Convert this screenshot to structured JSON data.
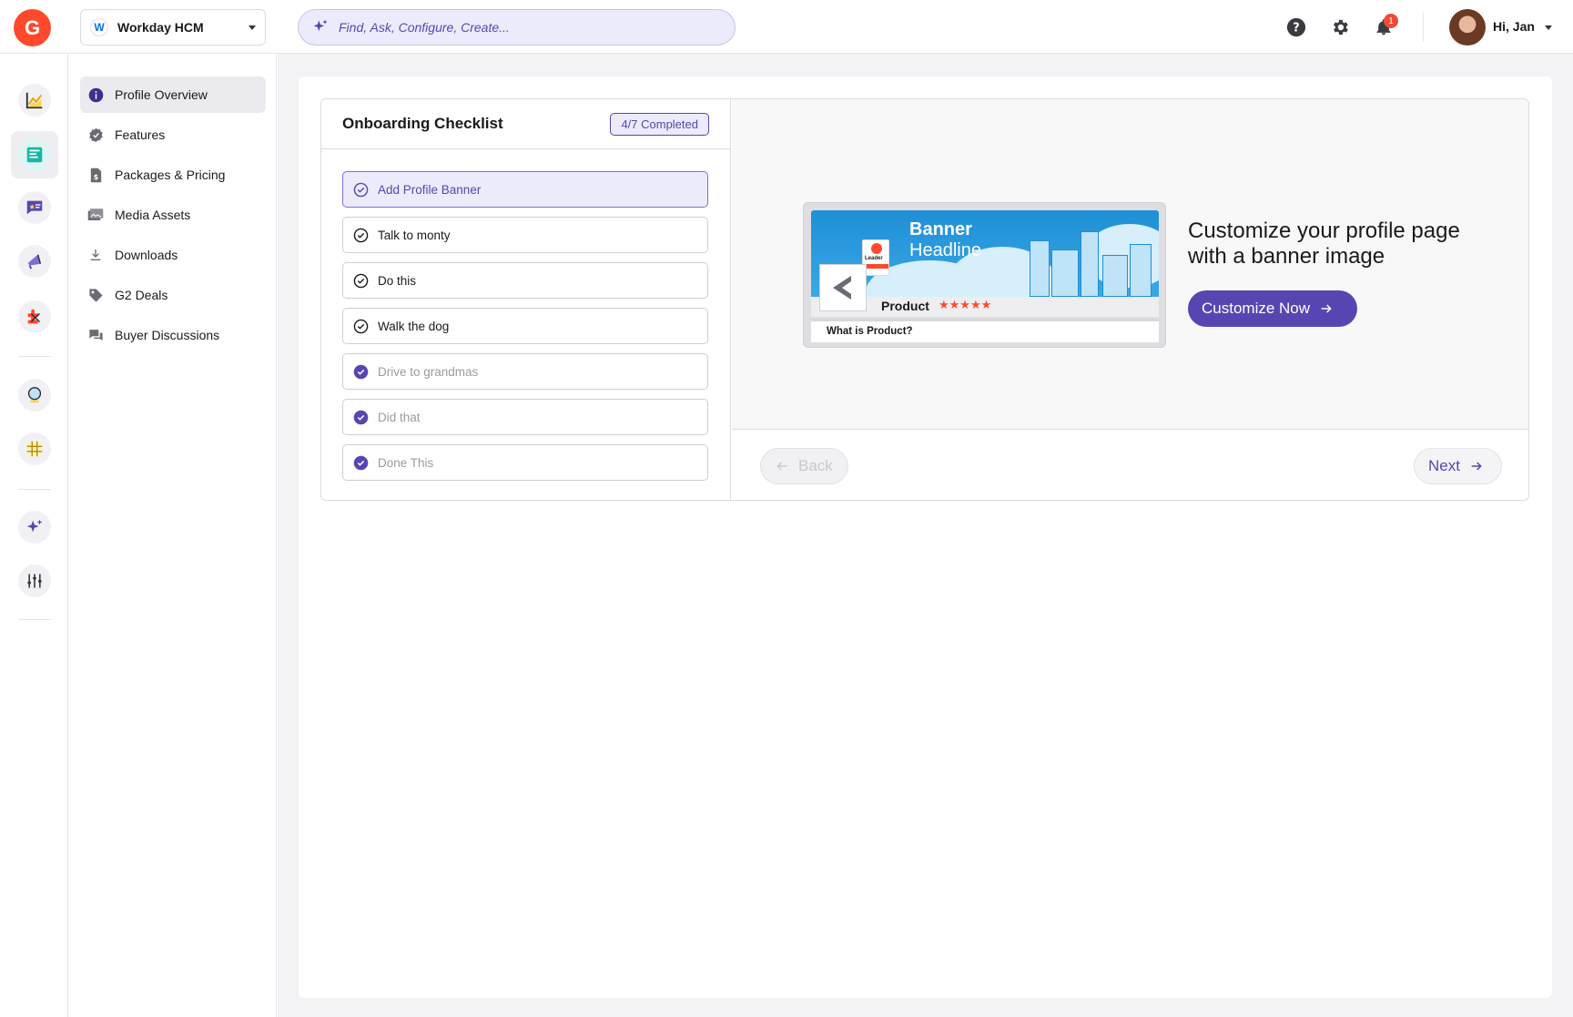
{
  "topbar": {
    "logo_text": "G",
    "product": {
      "name": "Workday HCM",
      "logo_letter": "W"
    },
    "search": {
      "placeholder": "Find, Ask, Configure, Create..."
    },
    "notifications_count": "1",
    "user_greeting": "Hi, Jan",
    "icons": [
      "help-icon",
      "gear-icon",
      "bell-icon"
    ]
  },
  "rail": {
    "items": [
      "reports-icon",
      "profile-icon",
      "reviews-icon",
      "marketing-icon",
      "integrations-icon",
      "insights-icon",
      "data-grid-icon",
      "ai-sparkle-icon",
      "settings-sliders-icon"
    ]
  },
  "subnav": {
    "items": [
      {
        "label": "Profile Overview",
        "icon": "info-icon",
        "active": true
      },
      {
        "label": "Features",
        "icon": "verified-badge-icon"
      },
      {
        "label": "Packages & Pricing",
        "icon": "price-doc-icon"
      },
      {
        "label": "Media Assets",
        "icon": "media-icon"
      },
      {
        "label": "Downloads",
        "icon": "download-icon"
      },
      {
        "label": "G2 Deals",
        "icon": "tag-icon"
      },
      {
        "label": "Buyer Discussions",
        "icon": "chat-icon"
      }
    ]
  },
  "checklist": {
    "title": "Onboarding Checklist",
    "progress": "4/7 Completed",
    "items": [
      {
        "label": "Add Profile Banner",
        "state": "active"
      },
      {
        "label": "Talk to monty",
        "state": "todo"
      },
      {
        "label": "Do this",
        "state": "todo"
      },
      {
        "label": "Walk the dog",
        "state": "todo"
      },
      {
        "label": "Drive to grandmas",
        "state": "done"
      },
      {
        "label": "Did that",
        "state": "done"
      },
      {
        "label": "Done This",
        "state": "done"
      }
    ]
  },
  "preview": {
    "banner": {
      "headline_line1": "Banner",
      "headline_line2": "Headline",
      "product_name": "Product",
      "stars": "★★★★★",
      "what_is": "What is Product?",
      "medal_text": "Leader"
    },
    "heading": "Customize your profile page with a banner image",
    "cta_label": "Customize Now",
    "back_label": "Back",
    "next_label": "Next"
  },
  "colors": {
    "brand": "#ff492c",
    "accent": "#5746b2",
    "accent_light": "#ecebfb"
  }
}
